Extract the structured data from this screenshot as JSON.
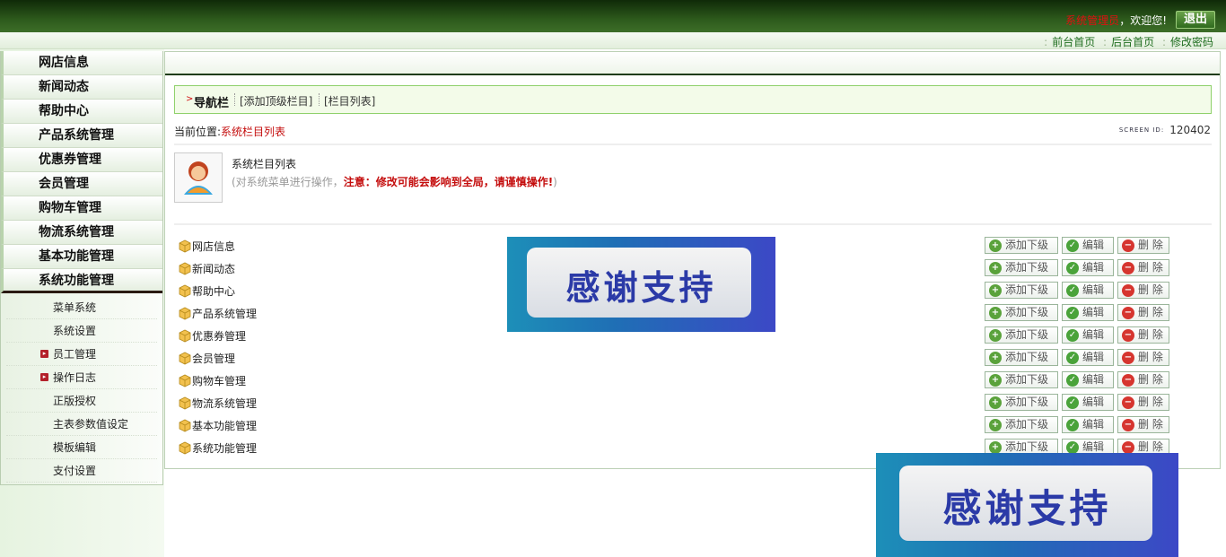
{
  "header": {
    "user": "系统管理员",
    "welcome": "，欢迎您!",
    "logout_label": "退出",
    "links": [
      "前台首页",
      "后台首页",
      "修改密码"
    ]
  },
  "sidebar": {
    "menu": [
      "网店信息",
      "新闻动态",
      "帮助中心",
      "产品系统管理",
      "优惠券管理",
      "会员管理",
      "购物车管理",
      "物流系统管理",
      "基本功能管理",
      "系统功能管理"
    ],
    "submenu": [
      {
        "label": "菜单系统",
        "bullet": false
      },
      {
        "label": "系统设置",
        "bullet": false
      },
      {
        "label": "员工管理",
        "bullet": true
      },
      {
        "label": "操作日志",
        "bullet": true
      },
      {
        "label": "正版授权",
        "bullet": false
      },
      {
        "label": "主表参数值设定",
        "bullet": false
      },
      {
        "label": "模板编辑",
        "bullet": false
      },
      {
        "label": "支付设置",
        "bullet": false
      }
    ]
  },
  "navbar": {
    "label": "导航栏",
    "items": [
      "[添加顶级栏目]",
      "[栏目列表]"
    ]
  },
  "location": {
    "prefix": "当前位置:",
    "current": "系统栏目列表"
  },
  "screen_id": {
    "label": "SCREEN ID:",
    "value": "120402"
  },
  "info": {
    "title": "系统栏目列表",
    "desc_prefix": "(对系统菜单进行操作，",
    "desc_warning": "注意：修改可能会影响到全局，请谨慎操作!",
    "desc_suffix": ")"
  },
  "rows": [
    "网店信息",
    "新闻动态",
    "帮助中心",
    "产品系统管理",
    "优惠券管理",
    "会员管理",
    "购物车管理",
    "物流系统管理",
    "基本功能管理",
    "系统功能管理"
  ],
  "row_actions": {
    "add": "添加下级",
    "edit": "编辑",
    "delete": "删 除"
  },
  "banner_text": "感谢支持",
  "colors": {
    "accent_green": "#2d5a1c",
    "warning_red": "#c40d0d"
  }
}
